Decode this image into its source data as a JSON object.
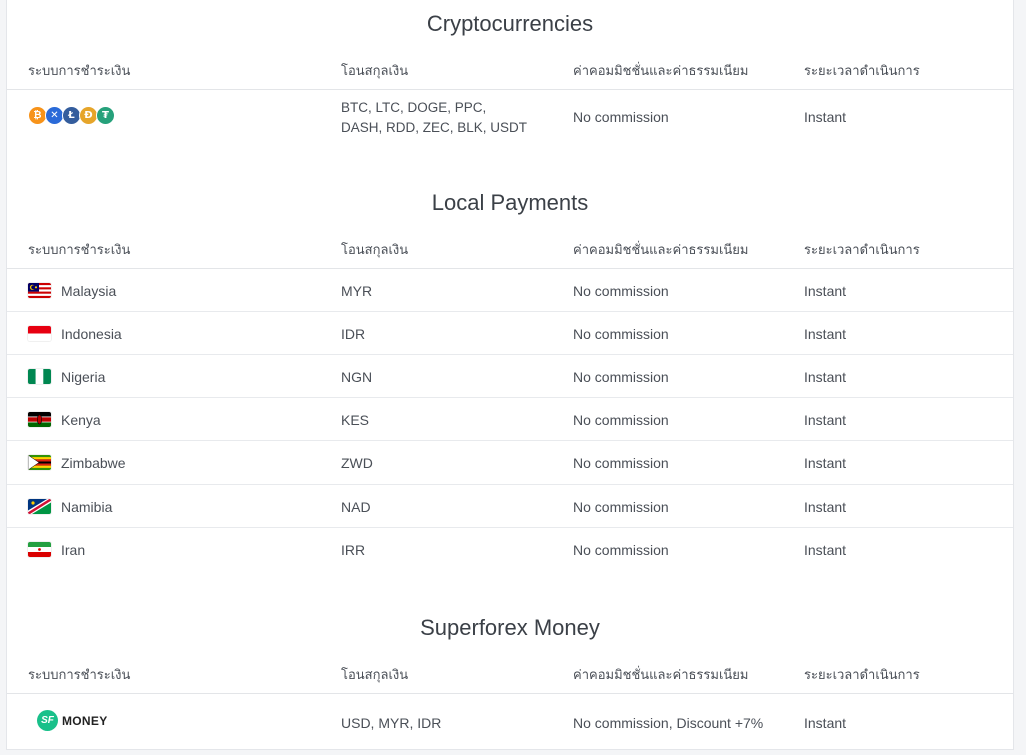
{
  "columns": {
    "method": "ระบบการชำระเงิน",
    "currency": "โอนสกุลเงิน",
    "commission": "ค่าคอมมิชชั่นและค่าธรรมเนียม",
    "time": "ระยะเวลาดำเนินการ"
  },
  "crypto": {
    "title": "Cryptocurrencies",
    "coin_icons": [
      "bitcoin-icon",
      "ripple-icon",
      "litecoin-icon",
      "dogecoin-icon",
      "tether-icon"
    ],
    "currencies": "BTC, LTC, DOGE, PPC, DASH, RDD, ZEC, BLK, USDT",
    "commission": "No commission",
    "time": "Instant"
  },
  "local": {
    "title": "Local Payments",
    "rows": [
      {
        "country": "Malaysia",
        "currency": "MYR",
        "commission": "No commission",
        "time": "Instant",
        "flag": "malaysia-flag-icon"
      },
      {
        "country": "Indonesia",
        "currency": "IDR",
        "commission": "No commission",
        "time": "Instant",
        "flag": "indonesia-flag-icon"
      },
      {
        "country": "Nigeria",
        "currency": "NGN",
        "commission": "No commission",
        "time": "Instant",
        "flag": "nigeria-flag-icon"
      },
      {
        "country": "Kenya",
        "currency": "KES",
        "commission": "No commission",
        "time": "Instant",
        "flag": "kenya-flag-icon"
      },
      {
        "country": "Zimbabwe",
        "currency": "ZWD",
        "commission": "No commission",
        "time": "Instant",
        "flag": "zimbabwe-flag-icon"
      },
      {
        "country": "Namibia",
        "currency": "NAD",
        "commission": "No commission",
        "time": "Instant",
        "flag": "namibia-flag-icon"
      },
      {
        "country": "Iran",
        "currency": "IRR",
        "commission": "No commission",
        "time": "Instant",
        "flag": "iran-flag-icon"
      }
    ]
  },
  "sfmoney": {
    "title": "Superforex Money",
    "logo_mark": "SF",
    "logo_word": "MONEY",
    "currencies": "USD, MYR, IDR",
    "commission": "No commission, Discount +7%",
    "time": "Instant"
  },
  "colors": {
    "brand_green": "#19c08a",
    "border": "#e3e5e8",
    "text": "#4a4f57"
  }
}
